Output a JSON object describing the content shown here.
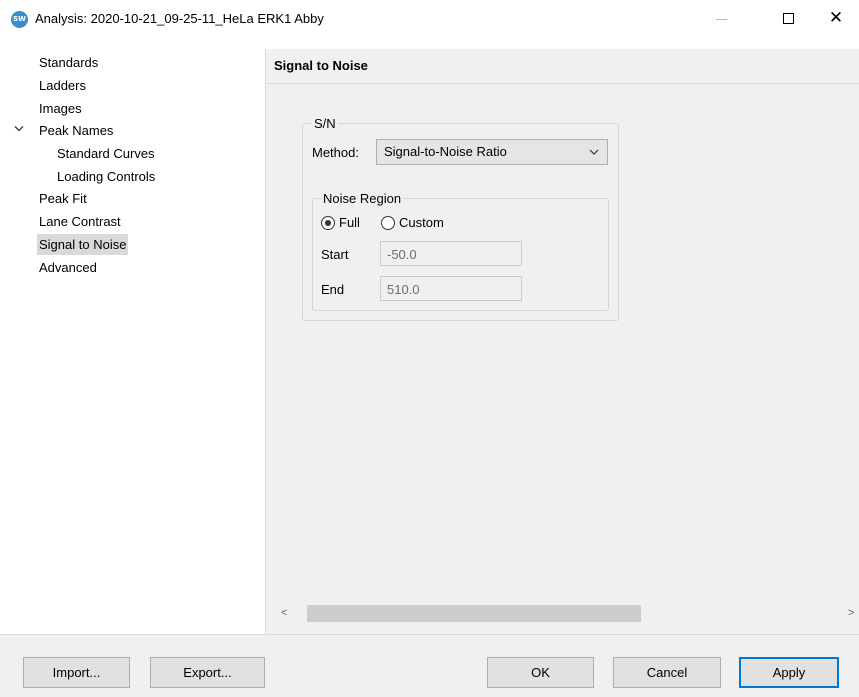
{
  "window": {
    "app_icon_text": "SW",
    "title": "Analysis: 2020-10-21_09-25-11_HeLa ERK1 Abby",
    "minimize_icon": "minimize-icon",
    "maximize_icon": "maximize-icon",
    "close_icon": "close-icon",
    "close_glyph": "✕"
  },
  "nav": {
    "items": [
      {
        "label": "Standards"
      },
      {
        "label": "Ladders"
      },
      {
        "label": "Images"
      },
      {
        "label": "Peak Names",
        "expanded": true
      },
      {
        "label": "Standard Curves"
      },
      {
        "label": "Loading Controls"
      },
      {
        "label": "Peak Fit"
      },
      {
        "label": "Lane Contrast"
      },
      {
        "label": "Signal to Noise",
        "selected": true
      },
      {
        "label": "Advanced"
      }
    ]
  },
  "panel": {
    "title": "Signal to Noise",
    "sn_group_label": "S/N",
    "method_label": "Method:",
    "method_value": "Signal-to-Noise Ratio",
    "noise_region_label": "Noise Region",
    "radio_full_label": "Full",
    "radio_full_selected": true,
    "radio_custom_label": "Custom",
    "radio_custom_selected": false,
    "start_label": "Start",
    "start_value": "-50.0",
    "end_label": "End",
    "end_value": "510.0"
  },
  "scrollbar": {
    "left_arrow": "<",
    "right_arrow": ">"
  },
  "buttons": {
    "import": "Import...",
    "export": "Export...",
    "ok": "OK",
    "cancel": "Cancel",
    "apply": "Apply"
  },
  "colors": {
    "accent": "#0078d7",
    "selected_nav": "#d9d9d9",
    "panel_bg": "#f0f0f0"
  }
}
